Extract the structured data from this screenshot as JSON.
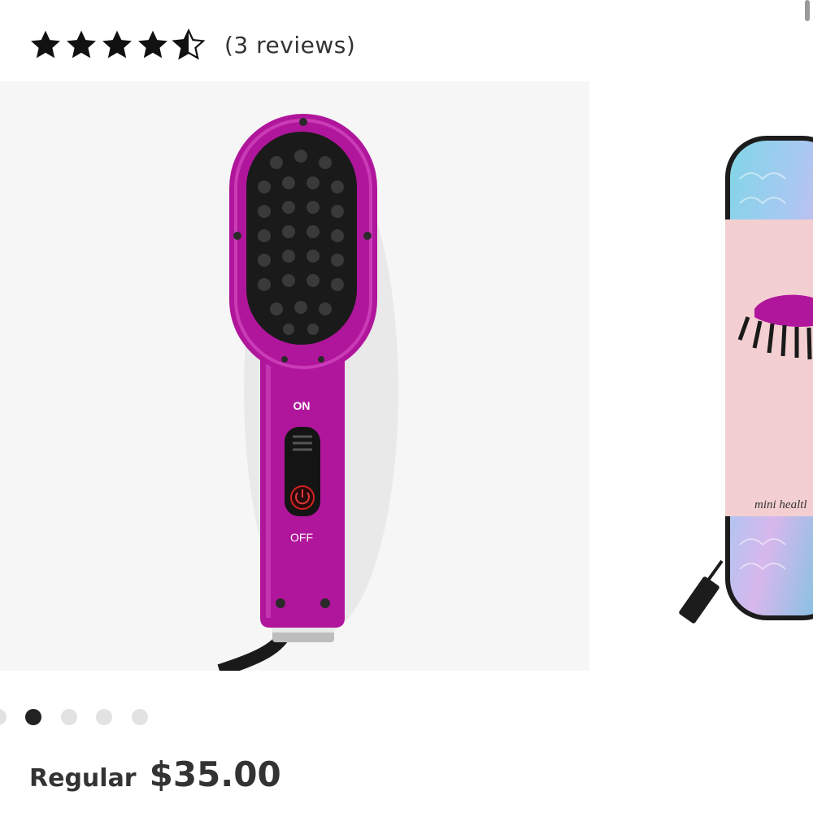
{
  "rating": {
    "value": 4.5,
    "max": 5,
    "reviews_text": "(3 reviews)"
  },
  "carousel": {
    "slides": [
      {
        "name": "straightening-brush-photo",
        "labels": {
          "on": "ON",
          "off": "OFF"
        },
        "colors": {
          "body": "#b0169b",
          "bristles": "#1a1a1a"
        }
      },
      {
        "name": "travel-case-photo",
        "caption": "mini healtl"
      }
    ],
    "active_index": 1,
    "dot_count": 5
  },
  "price": {
    "label": "Regular",
    "value": "$35.00"
  }
}
